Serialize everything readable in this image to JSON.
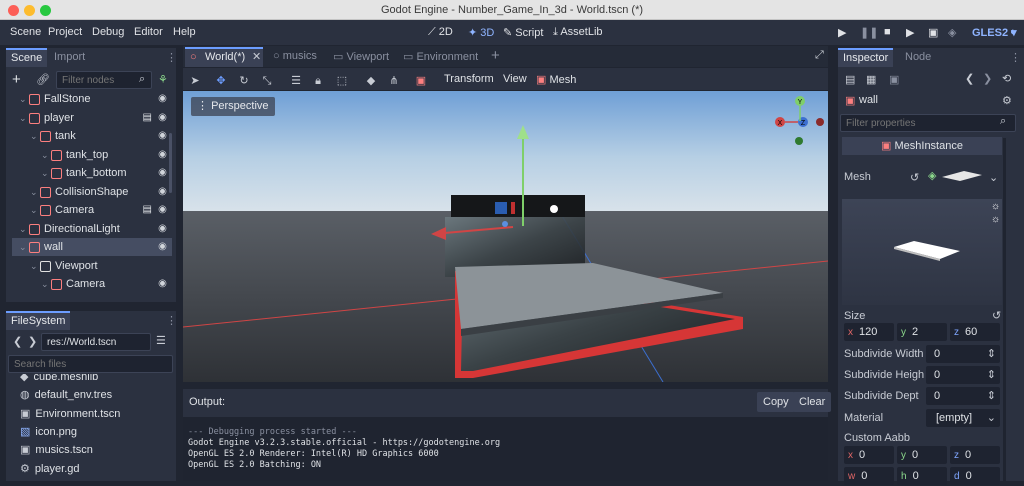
{
  "window": {
    "title": "Godot Engine - Number_Game_In_3d - World.tscn (*)"
  },
  "menu": {
    "items": [
      "Scene",
      "Project",
      "Debug",
      "Editor",
      "Help"
    ]
  },
  "workspaces": {
    "items": [
      "2D",
      "3D",
      "Script",
      "AssetLib"
    ],
    "active": "3D"
  },
  "renderer": "GLES2",
  "scene_dock": {
    "tabs": [
      "Scene",
      "Import"
    ],
    "filter_placeholder": "Filter nodes",
    "tree": [
      {
        "label": "FallStone",
        "icon_color": "#fc7f7f",
        "indent": 1
      },
      {
        "label": "player",
        "icon_color": "#fc7f7f",
        "indent": 1
      },
      {
        "label": "tank",
        "icon_color": "#fc7f7f",
        "indent": 2
      },
      {
        "label": "tank_top",
        "icon_color": "#fc7f7f",
        "indent": 3
      },
      {
        "label": "tank_bottom",
        "icon_color": "#fc7f7f",
        "indent": 3
      },
      {
        "label": "CollisionShape",
        "icon_color": "#fc7f7f",
        "indent": 2
      },
      {
        "label": "Camera",
        "icon_color": "#fc7f7f",
        "indent": 2
      },
      {
        "label": "DirectionalLight",
        "icon_color": "#fc7f7f",
        "indent": 1
      },
      {
        "label": "wall",
        "icon_color": "#fc7f7f",
        "indent": 1,
        "selected": true
      },
      {
        "label": "Viewport",
        "icon_color": "#e0e0e0",
        "indent": 2
      },
      {
        "label": "Camera",
        "icon_color": "#fc7f7f",
        "indent": 3
      }
    ]
  },
  "filesystem": {
    "tab": "FileSystem",
    "path": "res://World.tscn",
    "search_placeholder": "Search files",
    "files": [
      "cube.meshlib",
      "default_env.tres",
      "Environment.tscn",
      "icon.png",
      "musics.tscn",
      "player.gd"
    ]
  },
  "editor_tabs": [
    "World(*)",
    "musics",
    "Viewport",
    "Environment"
  ],
  "toolbar": {
    "transform": "Transform",
    "view": "View",
    "mesh": "Mesh"
  },
  "viewport": {
    "perspective_label": "Perspective",
    "gizmo": {
      "y": "Y",
      "x": "X",
      "z": "Z"
    }
  },
  "output": {
    "title": "Output:",
    "copy": "Copy",
    "clear": "Clear",
    "lines": [
      "--- Debugging process started ---",
      "Godot Engine v3.2.3.stable.official - https://godotengine.org",
      "OpenGL ES 2.0 Renderer: Intel(R) HD Graphics 6000",
      "OpenGL ES 2.0 Batching: ON"
    ]
  },
  "inspector": {
    "tabs": [
      "Inspector",
      "Node"
    ],
    "node_name": "wall",
    "filter_placeholder": "Filter properties",
    "class_name": "MeshInstance",
    "mesh_label": "Mesh",
    "size_label": "Size",
    "size": {
      "x": "120",
      "y": "2",
      "z": "60"
    },
    "subdivide_width_label": "Subdivide Width",
    "subdivide_width": "0",
    "subdivide_height_label": "Subdivide Heigh",
    "subdivide_height": "0",
    "subdivide_depth_label": "Subdivide Dept",
    "subdivide_depth": "0",
    "material_label": "Material",
    "material_value": "[empty]",
    "custom_aabb_label": "Custom Aabb",
    "aabb": {
      "x": "0",
      "y": "0",
      "z": "0",
      "w": "0",
      "h": "0",
      "d": "0"
    }
  }
}
